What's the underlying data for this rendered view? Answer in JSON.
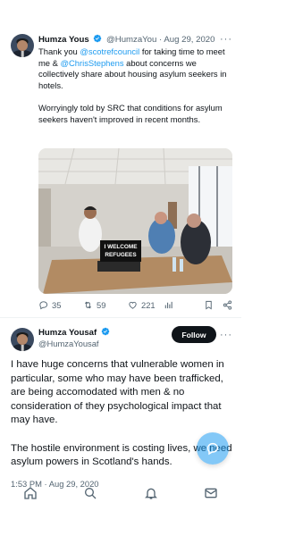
{
  "reply_tweet": {
    "name": "Humza Yous",
    "handle": "@HumzaYou",
    "separator": "·",
    "date": "Aug 29, 2020",
    "body_1_prefix": "Thank you ",
    "mention_1": "@scotrefcouncil",
    "body_1_middle": " for taking time to meet me & ",
    "mention_2": "@ChrisStephens",
    "body_1_suffix": " about concerns we collectively share about housing asylum seekers in hotels.",
    "body_2": "Worryingly told by SRC that conditions for asylum seekers haven't improved in recent months.",
    "photo_sign_line1": "I WELCOME",
    "photo_sign_line2": "REFUGEES",
    "stats": {
      "replies": "35",
      "retweets": "59",
      "likes": "221"
    },
    "icons": [
      "reply-icon",
      "retweet-icon",
      "like-icon",
      "analytics-icon",
      "bookmark-icon",
      "share-icon"
    ]
  },
  "main_tweet": {
    "name": "Humza Yousaf",
    "handle": "@HumzaYousaf",
    "follow_label": "Follow",
    "paragraph_1": "I have huge concerns that vulnerable women in particular, some who may have been trafficked, are being accomodated with men & no consideration of they psychological impact that may have.",
    "paragraph_2": "The hostile environment is costing lives, we need asylum powers in Scotland's hands.",
    "timestamp": "1:53 PM · Aug 29, 2020"
  },
  "bottom_nav": [
    "home-icon",
    "search-icon",
    "notifications-icon",
    "messages-icon"
  ],
  "colors": {
    "accent": "#1d9bf0",
    "text": "#0f1419",
    "secondary": "#536471",
    "follow_bg": "#0f1419"
  }
}
